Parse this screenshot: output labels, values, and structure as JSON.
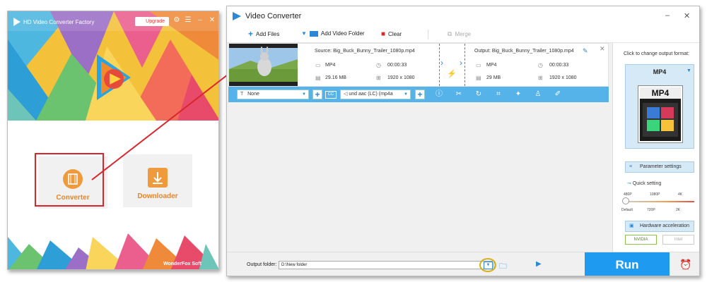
{
  "launcher": {
    "app_title": "HD Video Converter Factory",
    "upgrade_label": "Upgrade",
    "converter_label": "Converter",
    "downloader_label": "Downloader",
    "footer_brand": "WonderFox Soft"
  },
  "vc": {
    "title": "Video Converter",
    "toolbar": {
      "add_files": "Add Files",
      "add_video_folder": "Add Video Folder",
      "clear": "Clear",
      "merge": "Merge"
    },
    "task": {
      "source_name": "Source: Big_Buck_Bunny_Trailer_1080p.mp4",
      "output_name": "Output: Big_Buck_Bunny_Trailer_1080p.mp4",
      "src_format": "MP4",
      "src_duration": "00:00:33",
      "src_size": "29.16 MB",
      "src_resolution": "1920 x 1080",
      "out_format": "MP4",
      "out_duration": "00:00:33",
      "out_size": "29 MB",
      "out_resolution": "1920 x 1080"
    },
    "edit_bar": {
      "subtitle": "None",
      "audio": "und aac (LC) (mp4a"
    },
    "right_panel": {
      "hint": "Click to change output format:",
      "format": "MP4",
      "format_card_text": "MP4",
      "parameter_settings": "Parameter settings",
      "quick_setting": "Quick setting",
      "quality_top": [
        "480P",
        "1080P",
        "4K"
      ],
      "quality_bottom": [
        "Default",
        "720P",
        "2K"
      ],
      "hardware_accel": "Hardware acceleration",
      "nvidia": "NVIDIA",
      "intel": "Intel"
    },
    "bottom": {
      "output_folder_label": "Output folder:",
      "output_folder_value": "D:\\New folder",
      "run": "Run"
    }
  },
  "colors": {
    "accent_blue": "#1e9bf0",
    "highlight_red": "#d9262c",
    "tile_orange": "#e5862b"
  }
}
